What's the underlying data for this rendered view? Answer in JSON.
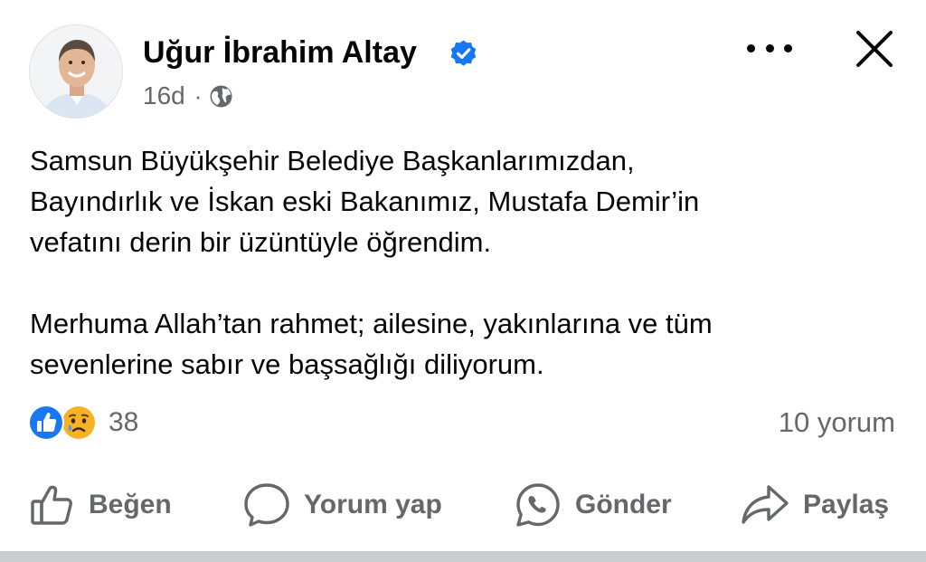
{
  "post": {
    "author": {
      "name": "Uğur İbrahim Altay",
      "verified": true,
      "avatar": "profile-photo"
    },
    "timestamp": "16d",
    "separator": "·",
    "privacy_icon": "globe-icon",
    "paragraphs": [
      [
        "Samsun Büyükşehir Belediye Başkanlarımızdan,",
        "Bayındırlık ve İskan eski Bakanımız, Mustafa Demir’in",
        "vefatını derin bir üzüntüyle öğrendim."
      ],
      [
        "Merhuma Allah’tan rahmet; ailesine, yakınlarına ve tüm",
        "sevenlerine sabır ve başsağlığı diliyorum."
      ]
    ],
    "reactions": {
      "types": [
        "like-reaction-icon",
        "sad-reaction-icon"
      ],
      "count": "38"
    },
    "comments_label": "10 yorum"
  },
  "actions": {
    "like": "Beğen",
    "comment": "Yorum yap",
    "send": "Gönder",
    "share": "Paylaş"
  },
  "colors": {
    "text_primary": "#050505",
    "text_secondary": "#65676b",
    "facebook_blue": "#1877f2",
    "verified_blue": "#1877f2",
    "divider": "#c9ccd1"
  }
}
